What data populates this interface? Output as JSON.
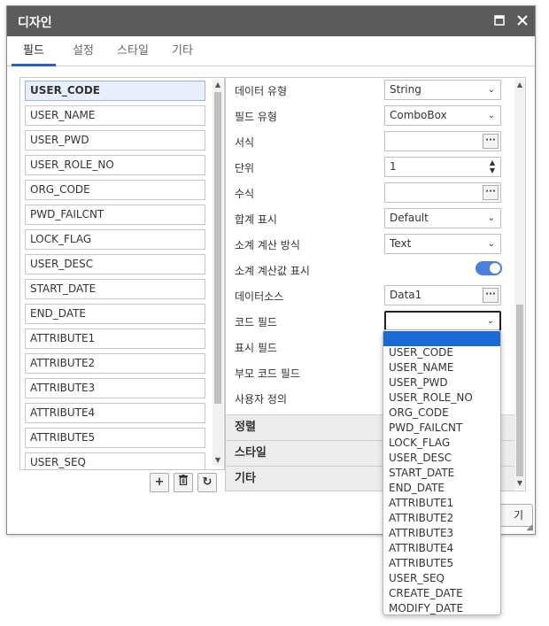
{
  "window": {
    "title": "디자인",
    "maximize_icon": "maximize-icon",
    "close_icon": "close-icon"
  },
  "tabs": [
    {
      "label": "필드",
      "active": true
    },
    {
      "label": "설정",
      "active": false
    },
    {
      "label": "스타일",
      "active": false
    },
    {
      "label": "기타",
      "active": false
    }
  ],
  "field_list": {
    "selected": "USER_CODE",
    "items": [
      "USER_CODE",
      "USER_NAME",
      "USER_PWD",
      "USER_ROLE_NO",
      "ORG_CODE",
      "PWD_FAILCNT",
      "LOCK_FLAG",
      "USER_DESC",
      "START_DATE",
      "END_DATE",
      "ATTRIBUTE1",
      "ATTRIBUTE2",
      "ATTRIBUTE3",
      "ATTRIBUTE4",
      "ATTRIBUTE5",
      "USER_SEQ"
    ],
    "buttons": {
      "add": "+",
      "delete": "🗑",
      "refresh": "↻"
    }
  },
  "properties": {
    "data_type": {
      "label": "데이터 유형",
      "value": "String"
    },
    "field_type": {
      "label": "필드 유형",
      "value": "ComboBox"
    },
    "format": {
      "label": "서식",
      "value": ""
    },
    "unit": {
      "label": "단위",
      "value": "1"
    },
    "formula": {
      "label": "수식",
      "value": ""
    },
    "total_display": {
      "label": "합계 표시",
      "value": "Default"
    },
    "subtotal_method": {
      "label": "소계 계산 방식",
      "value": "Text"
    },
    "subtotal_display": {
      "label": "소계 계산값 표시",
      "value": true
    },
    "datasource": {
      "label": "데이터소스",
      "value": "Data1"
    },
    "code_field": {
      "label": "코드 필드",
      "value": ""
    },
    "display_field": {
      "label": "표시 필드"
    },
    "parent_code_field": {
      "label": "부모 코드 필드"
    },
    "user_defined": {
      "label": "사용자 정의"
    }
  },
  "sections": {
    "sort": "정렬",
    "style": "스타일",
    "etc": "기타"
  },
  "footer": {
    "close_button_partial": "기"
  },
  "dropdown": {
    "highlighted": "",
    "options": [
      "USER_CODE",
      "USER_NAME",
      "USER_PWD",
      "USER_ROLE_NO",
      "ORG_CODE",
      "PWD_FAILCNT",
      "LOCK_FLAG",
      "USER_DESC",
      "START_DATE",
      "END_DATE",
      "ATTRIBUTE1",
      "ATTRIBUTE2",
      "ATTRIBUTE3",
      "ATTRIBUTE4",
      "ATTRIBUTE5",
      "USER_SEQ",
      "CREATE_DATE",
      "MODIFY_DATE"
    ]
  },
  "colors": {
    "titlebar": "#5b5b5b",
    "accent": "#2b5fb8",
    "highlight": "#1a6ad6",
    "toggle": "#4a7fe0"
  }
}
